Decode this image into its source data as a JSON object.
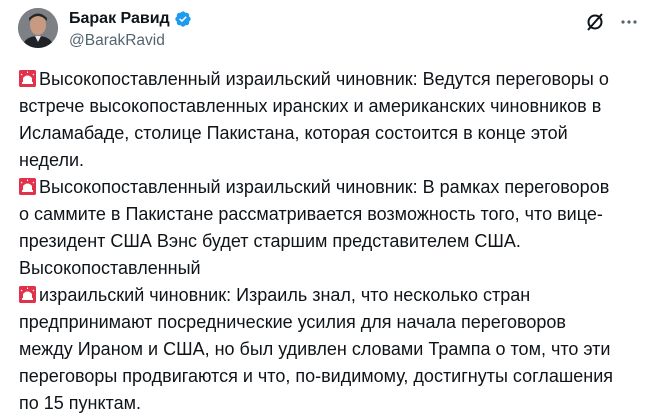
{
  "author": {
    "display_name": "Барак Равид",
    "handle": "@BarakRavid",
    "verified": true
  },
  "icons": {
    "verified": "verified-badge-icon",
    "grok": "grok-icon",
    "more": "more-options-icon",
    "siren": "rotating-light-emoji"
  },
  "tweet": {
    "lines": [
      {
        "emoji": true,
        "text": "Высокопоставленный израильский чиновник: Ведутся переговоры о"
      },
      {
        "emoji": false,
        "text": "встрече высокопоставленных иранских и американских чиновников в"
      },
      {
        "emoji": false,
        "text": "Исламабаде, столице Пакистана, которая состоится в конце этой"
      },
      {
        "emoji": false,
        "text": "недели."
      },
      {
        "emoji": true,
        "text": "Высокопоставленный израильский чиновник: В рамках переговоров"
      },
      {
        "emoji": false,
        "text": "о саммите в Пакистане рассматривается возможность того, что вице-"
      },
      {
        "emoji": false,
        "text": "президент США Вэнс будет старшим представителем США."
      },
      {
        "emoji": false,
        "text": "Высокопоставленный"
      },
      {
        "emoji": true,
        "text": "израильский чиновник: Израиль знал, что несколько стран"
      },
      {
        "emoji": false,
        "text": "предпринимают посреднические усилия для начала переговоров"
      },
      {
        "emoji": false,
        "text": "между Ираном и США, но был удивлен словами Трампа о том, что эти"
      },
      {
        "emoji": false,
        "text": "переговоры продвигаются и что, по-видимому, достигнуты соглашения"
      },
      {
        "emoji": false,
        "text": "по 15 пунктам."
      }
    ]
  },
  "colors": {
    "verified_blue": "#1d9bf0",
    "text": "#0f1419",
    "secondary_text": "#536471",
    "siren_red": "#e0334b"
  }
}
